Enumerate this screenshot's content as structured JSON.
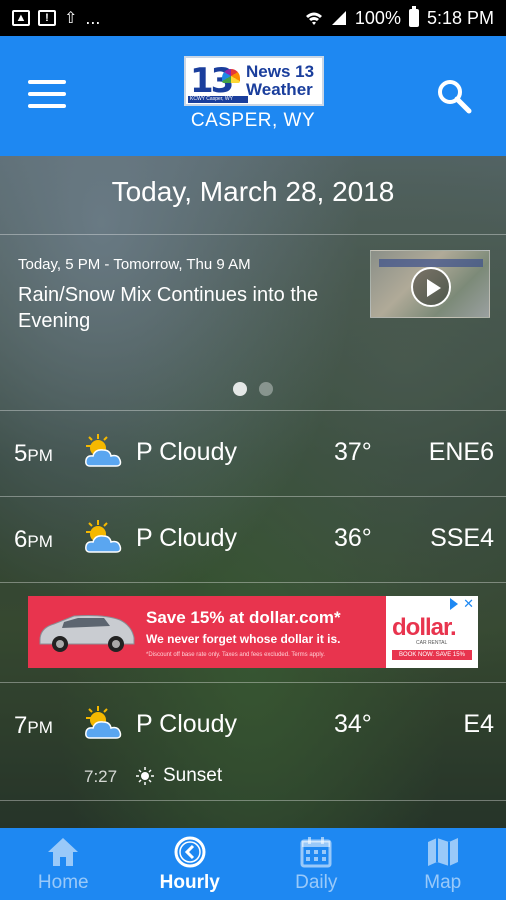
{
  "status_bar": {
    "time": "5:18 PM",
    "battery": "100%",
    "notif_icons": [
      "image-icon",
      "alert-icon",
      "upload-icon"
    ],
    "more": "...",
    "signal_icons": [
      "wifi-icon",
      "signal-icon",
      "battery-icon"
    ]
  },
  "header": {
    "logo_number": "13",
    "logo_line1": "News 13",
    "logo_line2": "Weather",
    "logo_sub": "KCWY Casper, WY",
    "location": "CASPER, WY",
    "accent_color": "#1e88f2"
  },
  "date": "Today, March 28, 2018",
  "story": {
    "time_range": "Today, 5 PM - Tomorrow, Thu 9 AM",
    "headline": "Rain/Snow Mix Continues into the Evening",
    "page": 1,
    "pages": 2
  },
  "hourly": [
    {
      "hour": "5",
      "ampm": "PM",
      "condition": "P Cloudy",
      "icon": "partly-cloudy-icon",
      "temp": "37°",
      "wind": "ENE6"
    },
    {
      "hour": "6",
      "ampm": "PM",
      "condition": "P Cloudy",
      "icon": "partly-cloudy-icon",
      "temp": "36°",
      "wind": "SSE4"
    },
    {
      "hour": "7",
      "ampm": "PM",
      "condition": "P Cloudy",
      "icon": "partly-cloudy-icon",
      "temp": "34°",
      "wind": "E4"
    }
  ],
  "sunset": {
    "time": "7:27",
    "label": "Sunset"
  },
  "ad": {
    "headline": "Save 15% at dollar.com*",
    "subline": "We never forget whose dollar it is.",
    "fine_print": "*Discount off base rate only. Taxes and fees excluded. Terms apply.",
    "brand": "dollar.",
    "brand_tag": "CAR RENTAL",
    "cta": "BOOK NOW. SAVE 15%",
    "color": "#e8344e"
  },
  "nav": {
    "tabs": [
      {
        "label": "Home",
        "icon": "home-icon",
        "active": false
      },
      {
        "label": "Hourly",
        "icon": "clock-icon",
        "active": true
      },
      {
        "label": "Daily",
        "icon": "calendar-icon",
        "active": false
      },
      {
        "label": "Map",
        "icon": "map-icon",
        "active": false
      }
    ]
  }
}
